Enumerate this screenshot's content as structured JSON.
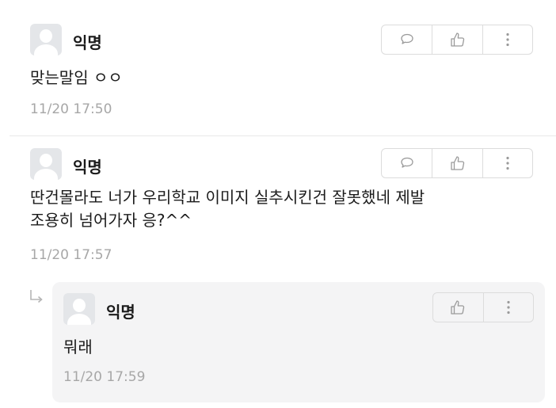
{
  "comments": [
    {
      "author": "익명",
      "text": "맞는말임 ㅇㅇ",
      "time": "11/20 17:50",
      "actions": [
        "comment-icon",
        "thumbs-up-icon",
        "more-icon"
      ]
    },
    {
      "author": "익명",
      "text": "딴건몰라도 너가 우리학교 이미지 실추시킨건 잘못했네 제발\n조용히 넘어가자 응?^^",
      "time": "11/20 17:57",
      "actions": [
        "comment-icon",
        "thumbs-up-icon",
        "more-icon"
      ]
    }
  ],
  "reply": {
    "author": "익명",
    "text": "뭐래",
    "time": "11/20 17:59",
    "actions": [
      "thumbs-up-icon",
      "more-icon"
    ]
  },
  "colors": {
    "avatar_bg": "#e4e6e9",
    "timestamp": "#a7a7a7",
    "reply_bg": "#f4f4f5",
    "border": "#dcdcdc"
  }
}
